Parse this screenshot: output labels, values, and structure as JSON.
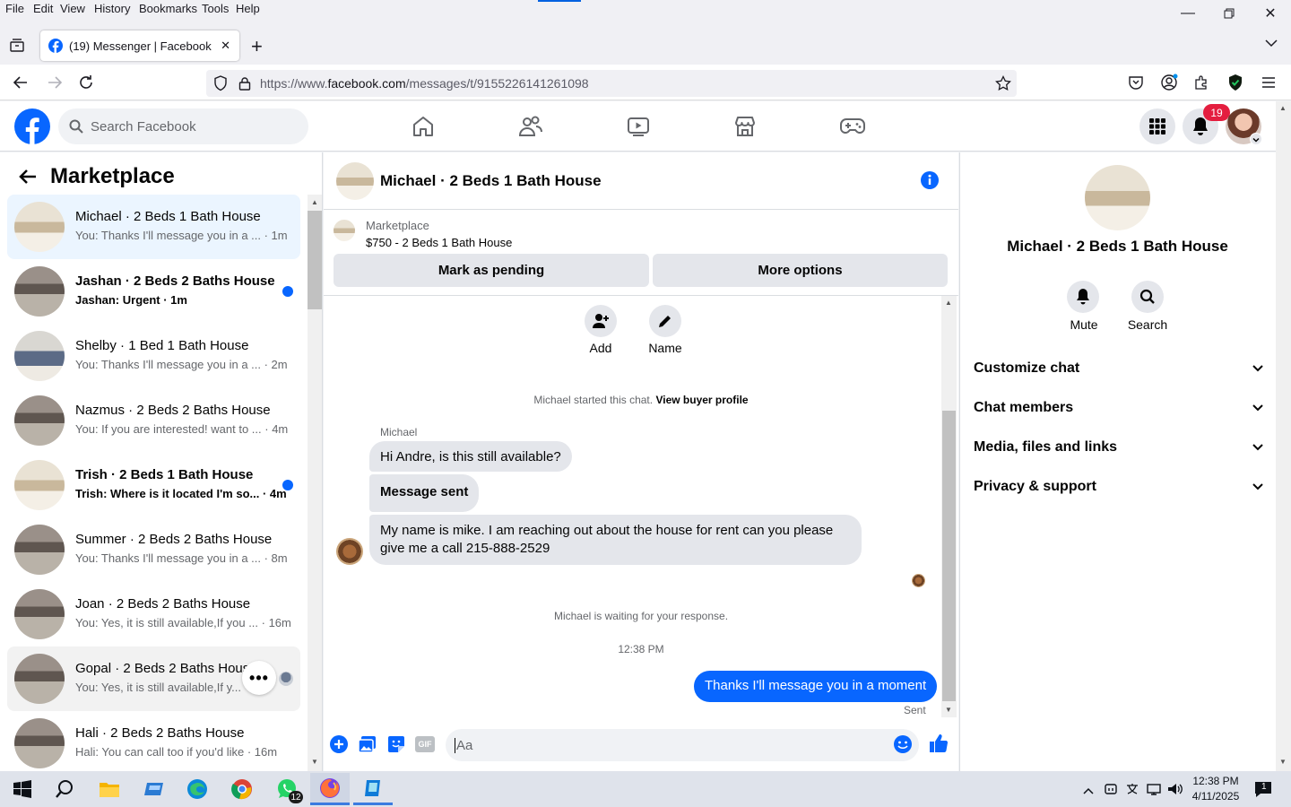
{
  "browser": {
    "menu": [
      "File",
      "Edit",
      "View",
      "History",
      "Bookmarks",
      "Tools",
      "Help"
    ],
    "tab_title": "(19) Messenger | Facebook",
    "url_prefix": "https://www.",
    "url_domain": "facebook.com",
    "url_path": "/messages/t/9155226141261098"
  },
  "facebook": {
    "search_placeholder": "Search Facebook",
    "notification_count": "19",
    "brand_color": "#0866ff"
  },
  "left_panel": {
    "title": "Marketplace",
    "conversations": [
      {
        "name": "Michael · 2 Beds 1 Bath House",
        "preview": "You: Thanks I'll message you in a ... · 1m",
        "selected": true,
        "unread": false
      },
      {
        "name": "Jashan · 2 Beds 2 Baths House",
        "preview": "Jashan: Urgent · 1m",
        "selected": false,
        "unread": true
      },
      {
        "name": "Shelby · 1 Bed 1 Bath House",
        "preview": "You: Thanks I'll message you in a ... · 2m",
        "selected": false,
        "unread": false
      },
      {
        "name": "Nazmus · 2 Beds 2 Baths House",
        "preview": "You: If you are interested! want to ... · 4m",
        "selected": false,
        "unread": false
      },
      {
        "name": "Trish · 2 Beds 1 Bath House",
        "preview": "Trish: Where is it located I'm so... · 4m",
        "selected": false,
        "unread": true
      },
      {
        "name": "Summer · 2 Beds 2 Baths House",
        "preview": "You: Thanks I'll message you in a ... · 8m",
        "selected": false,
        "unread": false
      },
      {
        "name": "Joan · 2 Beds 2 Baths House",
        "preview": "You: Yes, it is still available,If you ... · 16m",
        "selected": false,
        "unread": false
      },
      {
        "name": "Gopal · 2 Beds 2 Baths House",
        "preview": "You: Yes, it is still available,If y...",
        "selected": false,
        "unread": false
      },
      {
        "name": "Hali · 2 Beds 2 Baths House",
        "preview": "Hali: You can call too if you'd like · 16m",
        "selected": false,
        "unread": false
      }
    ]
  },
  "chat": {
    "title": "Michael · 2 Beds 1 Bath House",
    "listing_source": "Marketplace",
    "listing_title": "$750 - 2 Beds 1 Bath House",
    "btn_pending": "Mark as pending",
    "btn_more": "More options",
    "action_add": "Add",
    "action_name": "Name",
    "started_text": "Michael started this chat.",
    "view_profile": "View buyer profile",
    "sender_name": "Michael",
    "msg1": "Hi Andre, is this still available?",
    "msg2": "Message sent",
    "msg3_line1": "My name is mike. I am reaching out about the house for rent  can you please",
    "msg3_line2": "give me a call 215-888-2529",
    "waiting_text": "Michael is waiting for your response.",
    "timestamp": "12:38 PM",
    "my_msg": "Thanks I'll message you in a moment",
    "sent_status": "Sent",
    "input_placeholder": "Aa",
    "gif_label": "GIF"
  },
  "right_panel": {
    "title": "Michael · 2 Beds 1 Bath House",
    "mute": "Mute",
    "search": "Search",
    "sections": [
      "Customize chat",
      "Chat members",
      "Media, files and links",
      "Privacy & support"
    ]
  },
  "taskbar": {
    "time": "12:38 PM",
    "date": "4/11/2025",
    "whatsapp_badge": "12",
    "notif_badge": "1"
  }
}
